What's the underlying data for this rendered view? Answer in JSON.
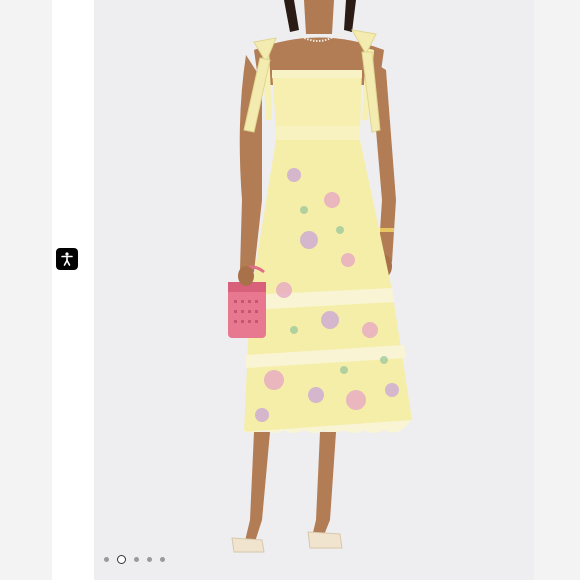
{
  "listing": {
    "image_alt": "",
    "product_colors": {
      "dress": "#f5eea8",
      "bag": "#e87890",
      "background": "#eeedf0"
    }
  },
  "accessibility": {
    "icon": "accessibility-icon"
  },
  "carousel": {
    "total_images": 5,
    "active_index": 1
  }
}
